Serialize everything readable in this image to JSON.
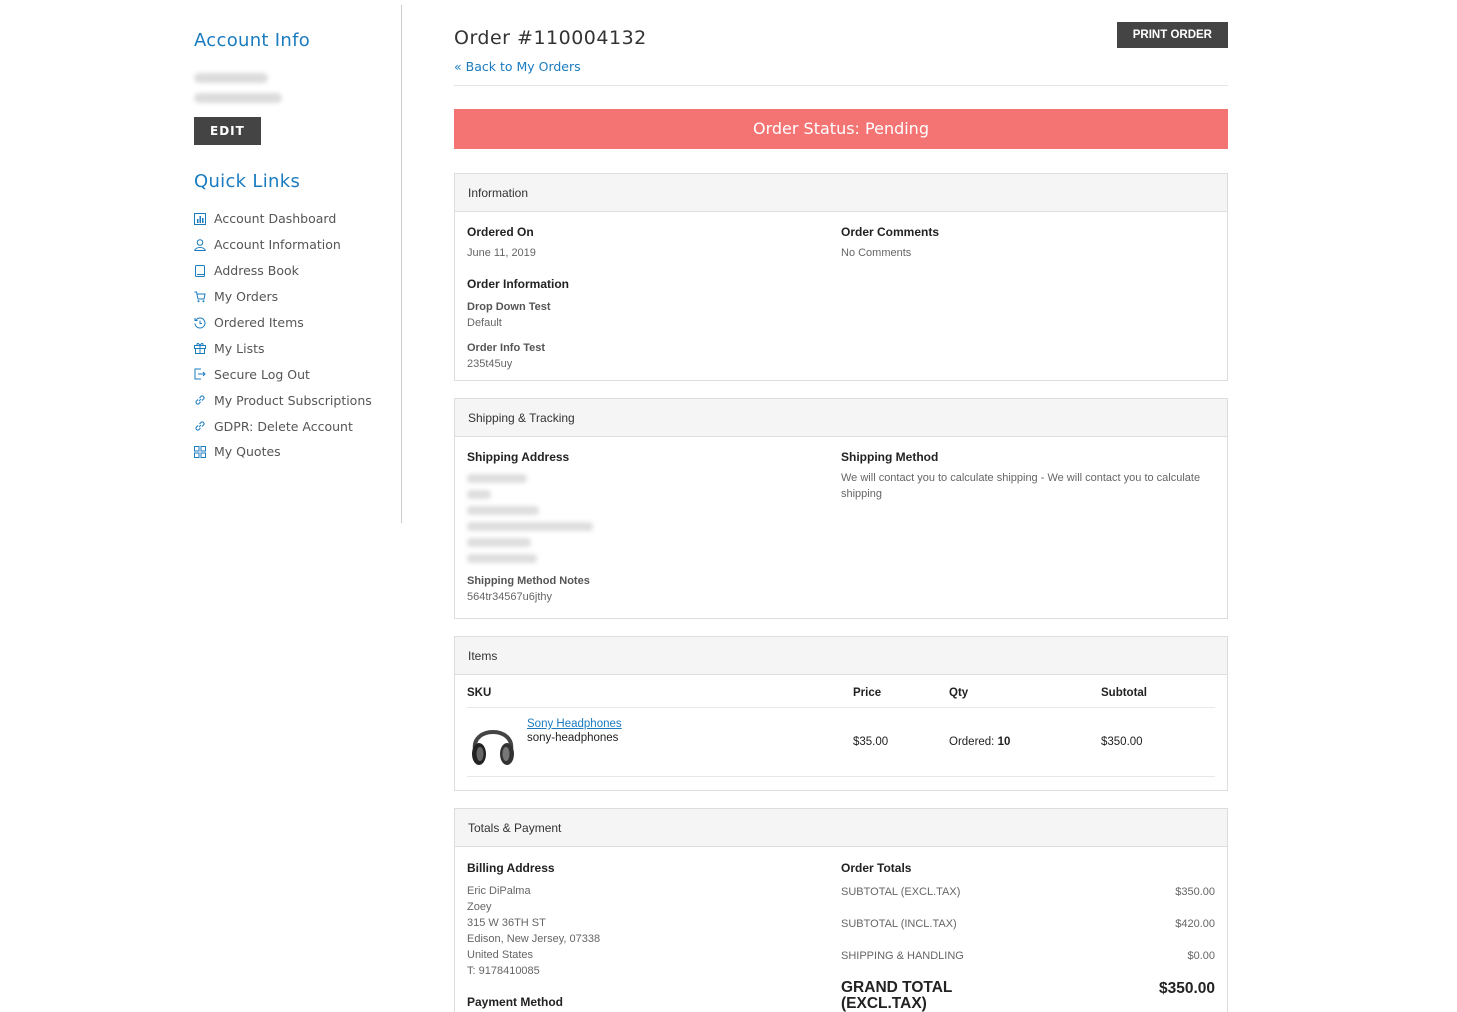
{
  "sidebar": {
    "account_heading": "Account Info",
    "edit_label": "EDIT",
    "quick_heading": "Quick Links",
    "links": [
      {
        "label": "Account Dashboard",
        "icon": "dashboard-icon"
      },
      {
        "label": "Account Information",
        "icon": "user-icon"
      },
      {
        "label": "Address Book",
        "icon": "book-icon"
      },
      {
        "label": "My Orders",
        "icon": "cart-icon"
      },
      {
        "label": "Ordered Items",
        "icon": "history-icon"
      },
      {
        "label": "My Lists",
        "icon": "gift-icon"
      },
      {
        "label": "Secure Log Out",
        "icon": "logout-icon"
      },
      {
        "label": "My Product Subscriptions",
        "icon": "link-icon"
      },
      {
        "label": "GDPR: Delete Account",
        "icon": "link-icon"
      },
      {
        "label": "My Quotes",
        "icon": "grid-icon"
      }
    ]
  },
  "header": {
    "title": "Order #110004132",
    "print_label": "PRINT ORDER",
    "back_link": "« Back to My Orders"
  },
  "status": {
    "text": "Order Status: Pending",
    "color": "#f47373"
  },
  "information": {
    "heading": "Information",
    "ordered_on_label": "Ordered On",
    "ordered_on_value": "June 11, 2019",
    "comments_label": "Order Comments",
    "comments_value": "No Comments",
    "order_info_label": "Order Information",
    "fields": [
      {
        "label": "Drop Down Test",
        "value": "Default"
      },
      {
        "label": "Order Info Test",
        "value": "235t45uy"
      }
    ]
  },
  "shipping": {
    "heading": "Shipping & Tracking",
    "address_label": "Shipping Address",
    "method_label": "Shipping Method",
    "method_value": "We will contact you to calculate shipping - We will contact you to calculate shipping",
    "notes_label": "Shipping Method Notes",
    "notes_value": "564tr34567u6jthy"
  },
  "items": {
    "heading": "Items",
    "columns": {
      "sku": "SKU",
      "price": "Price",
      "qty": "Qty",
      "subtotal": "Subtotal"
    },
    "rows": [
      {
        "name": "Sony Headphones",
        "sku": "sony-headphones",
        "price": "$35.00",
        "qty_label": "Ordered:",
        "qty_value": "10",
        "subtotal": "$350.00"
      }
    ]
  },
  "totals": {
    "heading": "Totals & Payment",
    "billing_label": "Billing Address",
    "billing_lines": [
      "Eric DiPalma",
      "Zoey",
      "315 W 36TH ST",
      "Edison, New Jersey, 07338",
      "United States",
      "T: 9178410085"
    ],
    "payment_label": "Payment Method",
    "order_totals_label": "Order Totals",
    "rows": [
      {
        "label": "SUBTOTAL (EXCL.TAX)",
        "value": "$350.00"
      },
      {
        "label": "SUBTOTAL (INCL.TAX)",
        "value": "$420.00"
      },
      {
        "label": "SHIPPING & HANDLING",
        "value": "$0.00"
      }
    ],
    "grand_label": "GRAND TOTAL (EXCL.TAX)",
    "grand_value": "$350.00"
  }
}
